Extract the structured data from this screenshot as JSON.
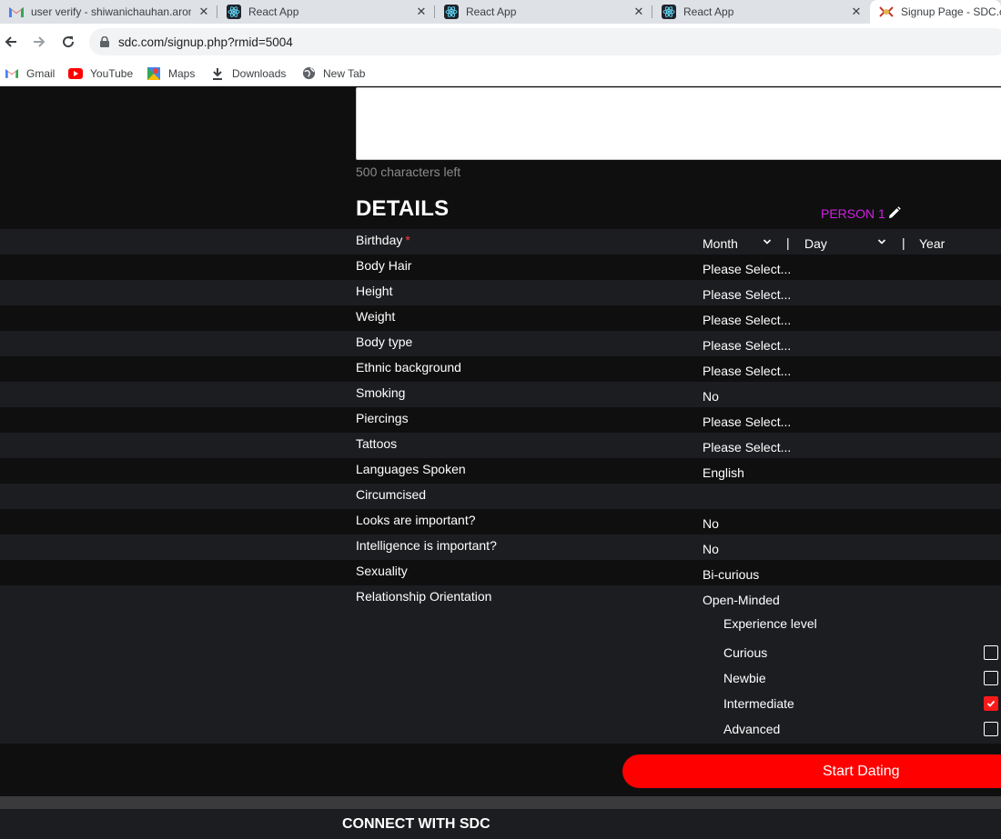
{
  "browser": {
    "tabs": [
      {
        "title": "user verify - shiwanichauhan.aron",
        "icon": "gmail-icon"
      },
      {
        "title": "React App",
        "icon": "react-icon"
      },
      {
        "title": "React App",
        "icon": "react-icon"
      },
      {
        "title": "React App",
        "icon": "react-icon"
      },
      {
        "title": "Signup Page - SDC.co",
        "icon": "sdc-icon"
      }
    ],
    "url": "sdc.com/signup.php?rmid=5004",
    "bookmarks": [
      {
        "label": "Gmail",
        "icon": "gmail-icon"
      },
      {
        "label": "YouTube",
        "icon": "youtube-icon"
      },
      {
        "label": "Maps",
        "icon": "maps-icon"
      },
      {
        "label": "Downloads",
        "icon": "download-icon"
      },
      {
        "label": "New Tab",
        "icon": "globe-icon"
      }
    ]
  },
  "form": {
    "chars_left": "500 characters left",
    "details_title": "DETAILS",
    "person_label": "PERSON 1",
    "birthday": {
      "label": "Birthday",
      "required_mark": "*",
      "month": "Month",
      "day": "Day",
      "year": "Year",
      "separator": "|"
    },
    "rows": [
      {
        "label": "Body Hair",
        "value": "Please Select..."
      },
      {
        "label": "Height",
        "value": "Please Select..."
      },
      {
        "label": "Weight",
        "value": "Please Select..."
      },
      {
        "label": "Body type",
        "value": "Please Select..."
      },
      {
        "label": "Ethnic background",
        "value": "Please Select..."
      },
      {
        "label": "Smoking",
        "value": "No"
      },
      {
        "label": "Piercings",
        "value": "Please Select..."
      },
      {
        "label": "Tattoos",
        "value": "Please Select..."
      },
      {
        "label": "Languages Spoken",
        "value": "English"
      },
      {
        "label": "Circumcised",
        "value": ""
      },
      {
        "label": "Looks are important?",
        "value": "No"
      },
      {
        "label": "Intelligence is important?",
        "value": "No"
      },
      {
        "label": "Sexuality",
        "value": "Bi-curious"
      },
      {
        "label": "Relationship Orientation",
        "value": "Open-Minded"
      }
    ],
    "experience": {
      "title": "Experience level",
      "options": [
        {
          "label": "Curious",
          "checked": false
        },
        {
          "label": "Newbie",
          "checked": false
        },
        {
          "label": "Intermediate",
          "checked": true
        },
        {
          "label": "Advanced",
          "checked": false
        }
      ]
    },
    "submit_label": "Start Dating"
  },
  "footer": {
    "title": "CONNECT WITH SDC"
  },
  "colors": {
    "accent_red": "#ff0000",
    "person_magenta": "#d21fe3",
    "page_bg": "#0f0f10",
    "row_alt_bg": "#1c1d20"
  }
}
